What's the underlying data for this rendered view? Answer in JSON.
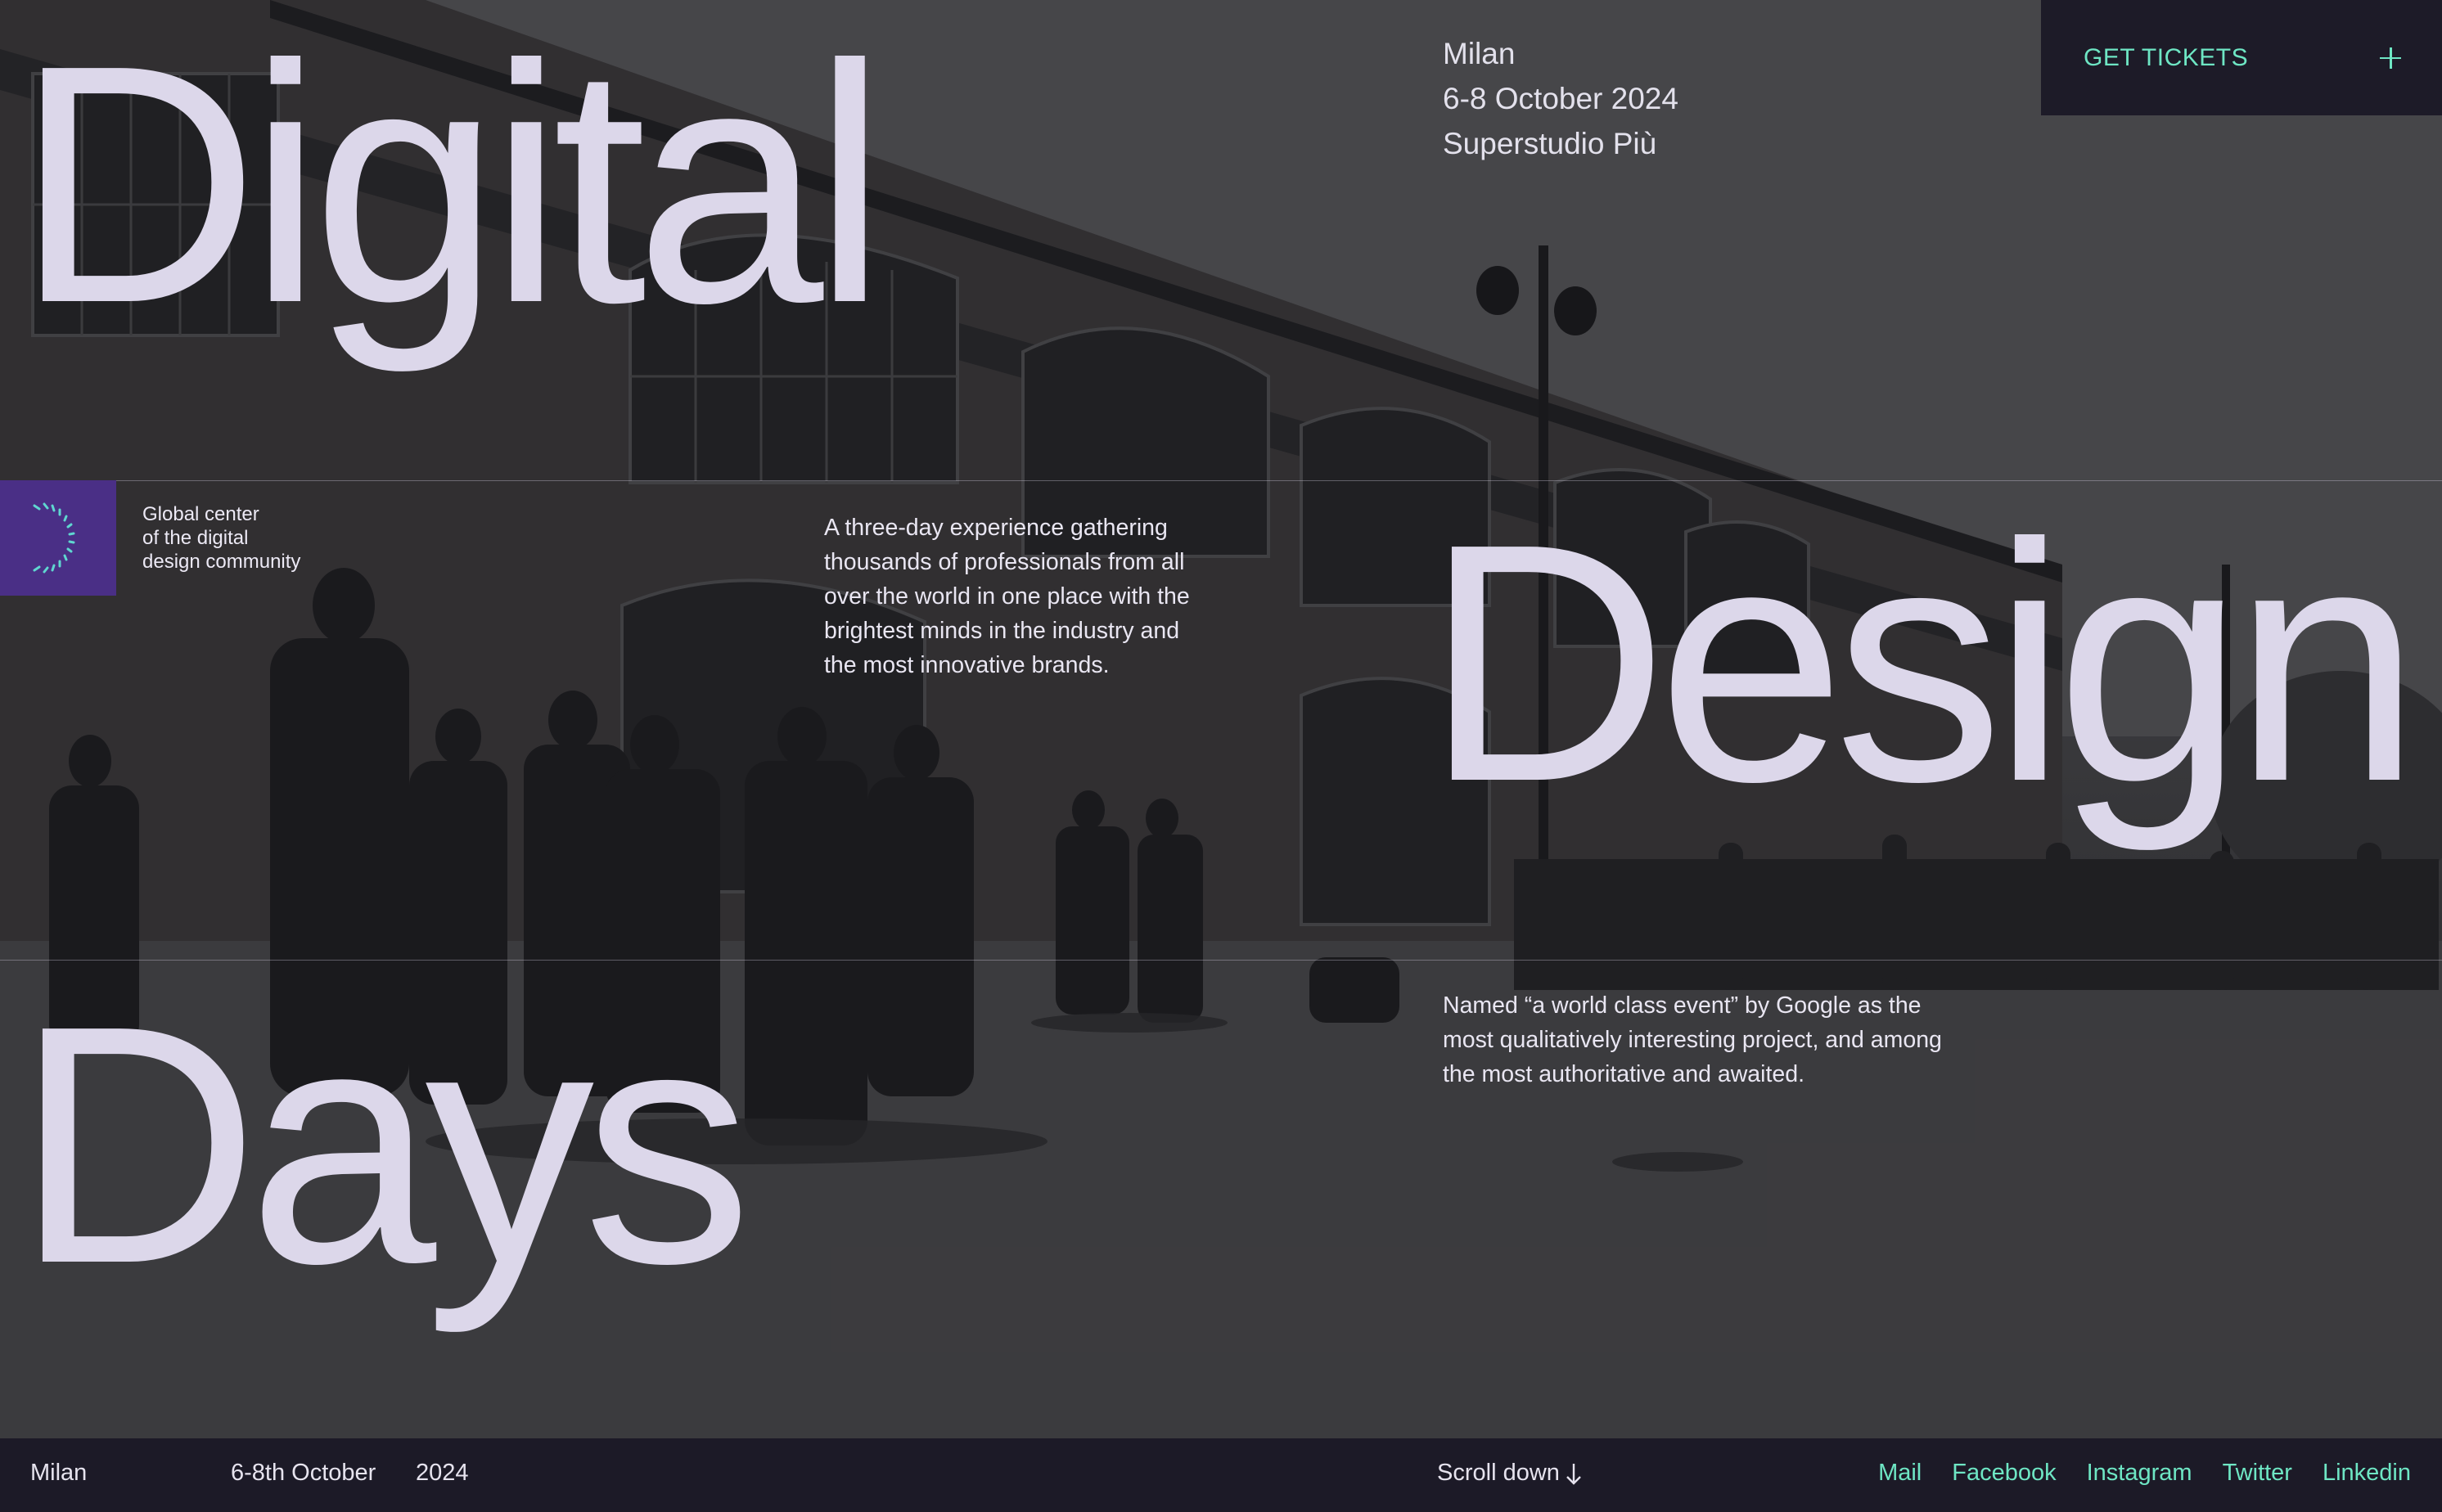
{
  "hero": {
    "words": [
      "Digital",
      "Design",
      "Days"
    ],
    "image_icon": "event-crowd-photo"
  },
  "event_info": {
    "city": "Milan",
    "dates": "6-8 October 2024",
    "venue": "Superstudio Più"
  },
  "tickets": {
    "label": "GET TICKETS",
    "icon": "plus-icon"
  },
  "brand": {
    "logo_icon": "ddd-arc-logo-icon",
    "tagline": [
      "Global center",
      "of the digital",
      "design community"
    ]
  },
  "intro_text": "A three-day experience gathering thousands of professionals from all over the world in one place with the brightest minds in the industry and the most innovative brands.",
  "quote_text": "Named “a world class event” by Google as the most qualitatively interesting project, and among the most authoritative and awaited.",
  "footer": {
    "city": "Milan",
    "date": "6-8th October",
    "year": "2024",
    "scroll_label": "Scroll down",
    "scroll_icon": "arrow-down-icon",
    "links": [
      "Mail",
      "Facebook",
      "Instagram",
      "Twitter",
      "Linkedin"
    ]
  },
  "colors": {
    "accent": "#6ee6c4",
    "dark": "#1c1a27",
    "logo_bg": "#4a2f86",
    "title": "#dcd7ea"
  }
}
